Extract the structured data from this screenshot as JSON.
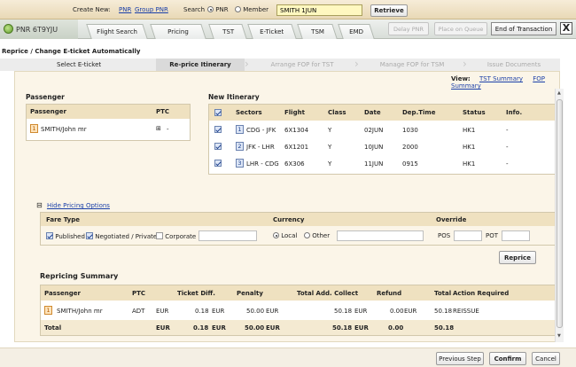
{
  "topbar": {
    "create_new_label": "Create New:",
    "pnr_link": "PNR",
    "group_pnr_link": "Group PNR",
    "search_label": "Search",
    "radio_pnr": "PNR",
    "radio_member": "Member",
    "search_value": "SMITH 1JUN",
    "retrieve_label": "Retrieve"
  },
  "tabs": {
    "pnr_tab": "PNR 6T9YJU",
    "items": [
      "Flight Search",
      "Pricing",
      "TST",
      "E-Ticket",
      "TSM",
      "EMD"
    ],
    "delay_pnr": "Delay PNR",
    "place_on_queue": "Place on Queue",
    "end_of_transaction": "End of Transaction",
    "close": "X"
  },
  "page_title": "Reprice / Change E-ticket Automatically",
  "steps": [
    "Select E-ticket",
    "Re-price Itinerary",
    "Arrange FOP for TST",
    "Manage FOP for TSM",
    "Issue Documents"
  ],
  "view": {
    "label": "View:",
    "tst_summary": "TST Summary",
    "fop_summary": "FOP Summary"
  },
  "passenger": {
    "section_title": "Passenger",
    "headers": [
      "Passenger",
      "PTC"
    ],
    "rows": [
      {
        "num": "1",
        "name": "SMITH/John mr",
        "ptc": "-"
      }
    ]
  },
  "itinerary": {
    "section_title": "New Itinerary",
    "headers": [
      "Sectors",
      "Flight",
      "Class",
      "Date",
      "Dep.Time",
      "Status",
      "Info."
    ],
    "rows": [
      {
        "num": "1",
        "sector": "CDG - JFK",
        "flight": "6X1304",
        "class": "Y",
        "date": "02JUN",
        "time": "1030",
        "status": "HK1",
        "info": "-"
      },
      {
        "num": "2",
        "sector": "JFK - LHR",
        "flight": "6X1201",
        "class": "Y",
        "date": "10JUN",
        "time": "2000",
        "status": "HK1",
        "info": "-"
      },
      {
        "num": "3",
        "sector": "LHR - CDG",
        "flight": "6X306",
        "class": "Y",
        "date": "11JUN",
        "time": "0915",
        "status": "HK1",
        "info": "-"
      }
    ]
  },
  "pricing_options": {
    "toggle_label": "Hide Pricing Options",
    "fare_type_label": "Fare Type",
    "currency_label": "Currency",
    "override_label": "Override",
    "published": "Published",
    "negotiated": "Negotiated / Private",
    "corporate": "Corporate",
    "local": "Local",
    "other": "Other",
    "pos": "POS",
    "pot": "POT",
    "reprice_label": "Reprice"
  },
  "summary": {
    "section_title": "Repricing Summary",
    "headers": [
      "Passenger",
      "PTC",
      "Ticket Diff.",
      "Penalty",
      "Total Add. Collect",
      "Refund",
      "Total",
      "Action Required"
    ],
    "row": {
      "num": "1",
      "name": "SMITH/John mr",
      "ptc": "ADT",
      "tdiff_cur": "EUR",
      "tdiff": "0.18",
      "pen_cur": "EUR",
      "pen": "50.00",
      "add_cur": "EUR",
      "add": "50.18",
      "ref_cur": "EUR",
      "ref": "0.00",
      "tot_cur": "EUR",
      "tot": "50.18",
      "action": "REISSUE"
    },
    "total": {
      "label": "Total",
      "tdiff_cur": "EUR",
      "tdiff": "0.18",
      "pen_cur": "EUR",
      "pen": "50.00",
      "add_cur": "EUR",
      "add": "50.18",
      "ref_cur": "EUR",
      "ref": "0.00",
      "tot": "50.18"
    }
  },
  "footer": {
    "previous": "Previous Step",
    "confirm": "Confirm",
    "cancel": "Cancel"
  },
  "icons": {
    "expand": "⊞",
    "collapse": "⊟",
    "scroll_up": "▲",
    "scroll_down": "▼"
  }
}
